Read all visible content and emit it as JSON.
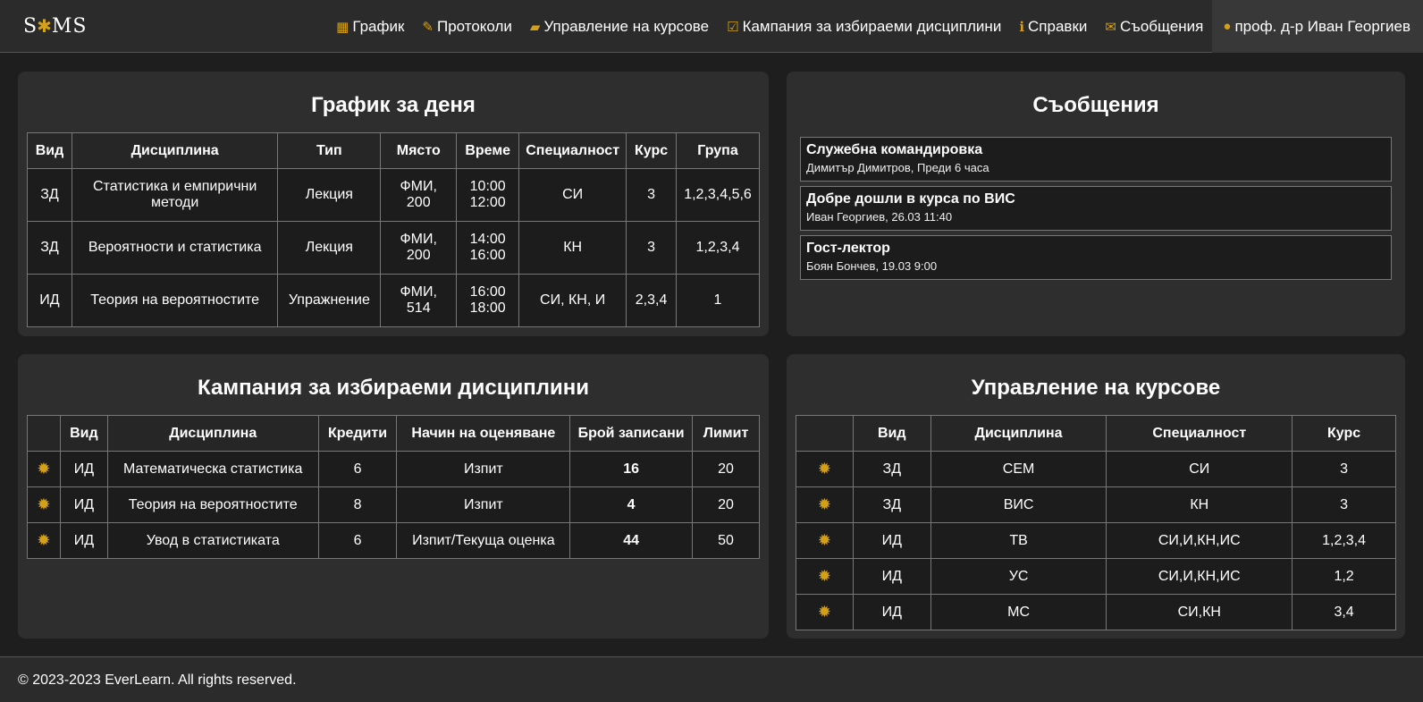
{
  "brand": {
    "logo_text_left": "S",
    "logo_bee": "✱",
    "logo_text_right": "MS"
  },
  "nav": {
    "items": [
      {
        "icon": "calendar-icon",
        "glyph": "▦",
        "label": "График"
      },
      {
        "icon": "pencil-icon",
        "glyph": "✎",
        "label": "Протоколи"
      },
      {
        "icon": "folder-open-icon",
        "glyph": "▰",
        "label": "Управление на курсове"
      },
      {
        "icon": "check-square-icon",
        "glyph": "☑",
        "label": "Кампания за избираеми дисциплини"
      },
      {
        "icon": "info-circle-icon",
        "glyph": "ℹ",
        "label": "Справки"
      },
      {
        "icon": "envelope-icon",
        "glyph": "✉",
        "label": "Съобщения"
      },
      {
        "icon": "user-icon",
        "glyph": "●",
        "label": "проф. д-р Иван Георгиев"
      }
    ]
  },
  "schedule": {
    "title": "График за деня",
    "headers": [
      "Вид",
      "Дисциплина",
      "Тип",
      "Място",
      "Време",
      "Специалност",
      "Курс",
      "Група"
    ],
    "rows": [
      [
        "ЗД",
        "Статистика и емпирични методи",
        "Лекция",
        "ФМИ, 200",
        "10:00 12:00",
        "СИ",
        "3",
        "1,2,3,4,5,6"
      ],
      [
        "ЗД",
        "Вероятности и статистика",
        "Лекция",
        "ФМИ, 200",
        "14:00 16:00",
        "КН",
        "3",
        "1,2,3,4"
      ],
      [
        "ИД",
        "Теория на вероятностите",
        "Упражнение",
        "ФМИ, 514",
        "16:00 18:00",
        "СИ, КН, И",
        "2,3,4",
        "1"
      ]
    ]
  },
  "messages": {
    "title": "Съобщения",
    "items": [
      {
        "title": "Служебна командировка",
        "meta": "Димитър Димитров, Преди 6 часа"
      },
      {
        "title": "Добре дошли в курса по ВИС",
        "meta": "Иван Георгиев, 26.03 11:40"
      },
      {
        "title": "Гост-лектор",
        "meta": "Боян Бончев, 19.03 9:00"
      }
    ]
  },
  "campaign": {
    "title": "Кампания за избираеми дисциплини",
    "headers": [
      "",
      "Вид",
      "Дисциплина",
      "Кредити",
      "Начин на оценяване",
      "Брой записани",
      "Лимит"
    ],
    "rows": [
      [
        "ИД",
        "Математическа статистика",
        "6",
        "Изпит",
        "16",
        "20"
      ],
      [
        "ИД",
        "Теория на вероятностите",
        "8",
        "Изпит",
        "4",
        "20"
      ],
      [
        "ИД",
        "Увод в статистиката",
        "6",
        "Изпит/Текуща оценка",
        "44",
        "50"
      ]
    ]
  },
  "courses": {
    "title": "Управление на курсове",
    "headers": [
      "",
      "Вид",
      "Дисциплина",
      "Специалност",
      "Курс"
    ],
    "rows": [
      [
        "ЗД",
        "СЕМ",
        "СИ",
        "3"
      ],
      [
        "ЗД",
        "ВИС",
        "КН",
        "3"
      ],
      [
        "ИД",
        "ТВ",
        "СИ,И,КН,ИС",
        "1,2,3,4"
      ],
      [
        "ИД",
        "УС",
        "СИ,И,КН,ИС",
        "1,2"
      ],
      [
        "ИД",
        "МС",
        "СИ,КН",
        "3,4"
      ]
    ]
  },
  "footer": {
    "text": "© 2023-2023 EverLearn. All rights reserved."
  },
  "colors": {
    "accent": "#d4a017",
    "background": "#1e1e1e",
    "card": "#2e2e2e"
  }
}
